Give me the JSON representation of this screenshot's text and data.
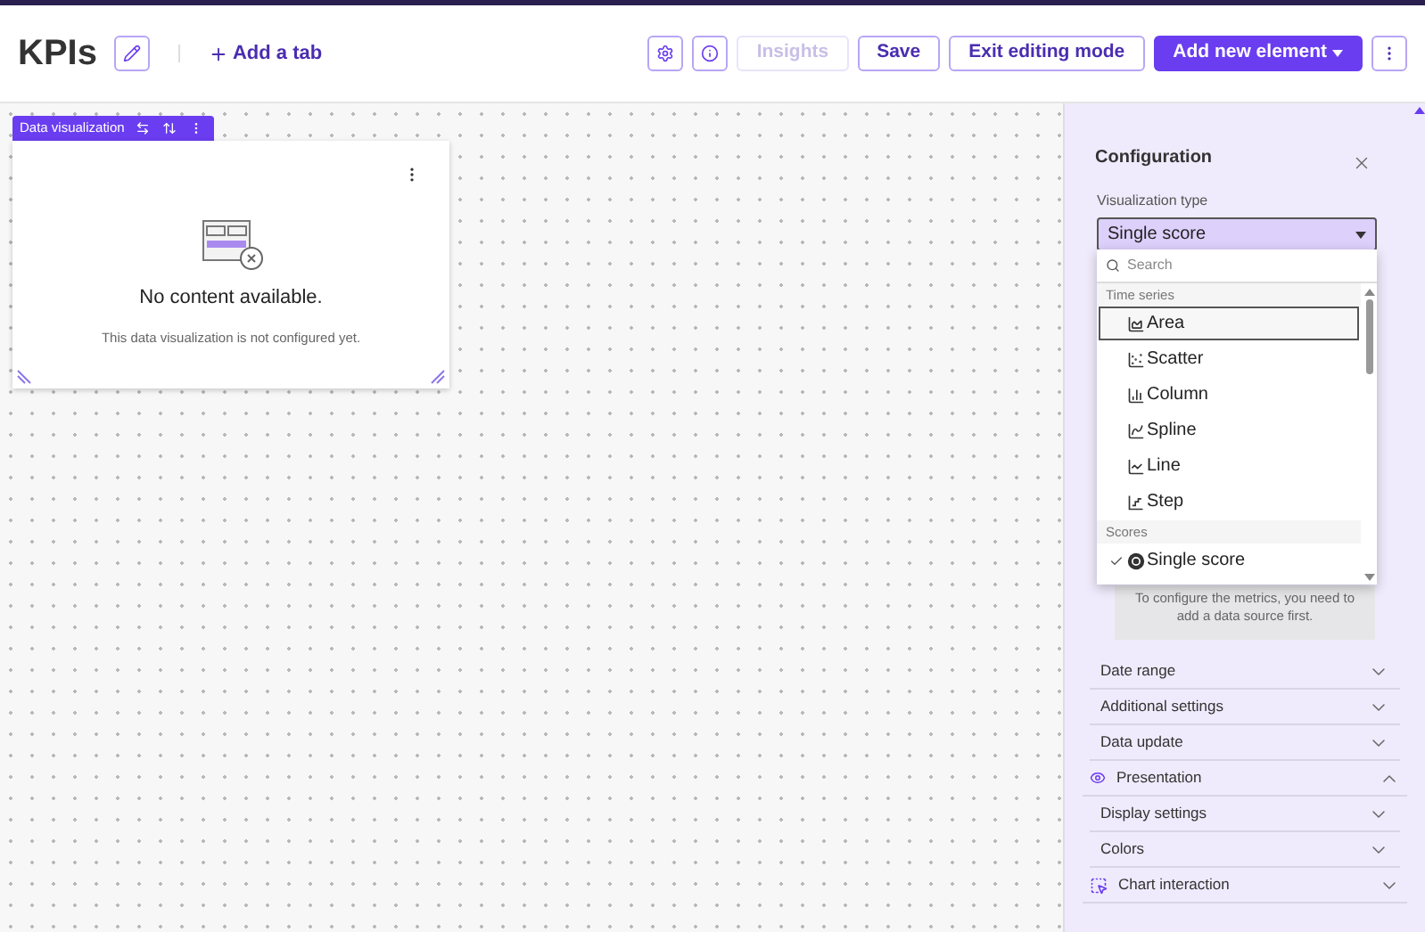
{
  "header": {
    "title": "KPIs",
    "add_tab": "Add a tab",
    "buttons": [
      {
        "label": "Insights",
        "disabled": true,
        "primary": false
      },
      {
        "label": "Save",
        "disabled": false,
        "primary": false
      },
      {
        "label": "Exit editing mode",
        "disabled": false,
        "primary": false
      },
      {
        "label": "Add new element",
        "disabled": false,
        "primary": true
      }
    ]
  },
  "widget": {
    "toolbar_label": "Data visualization",
    "empty_title": "No content available.",
    "empty_text": "This data visualization is not configured yet."
  },
  "panel": {
    "title": "Configuration",
    "field_label": "Visualization type",
    "field_value": "Single score",
    "dropdown": {
      "placeholder": "Search",
      "groups": [
        {
          "label": "Time series",
          "options": [
            {
              "kind": "area",
              "label": "Area",
              "selected": true,
              "checked": false
            },
            {
              "kind": "scatter",
              "label": "Scatter",
              "selected": false,
              "checked": false
            },
            {
              "kind": "column",
              "label": "Column",
              "selected": false,
              "checked": false
            },
            {
              "kind": "spline",
              "label": "Spline",
              "selected": false,
              "checked": false
            },
            {
              "kind": "line",
              "label": "Line",
              "selected": false,
              "checked": false
            },
            {
              "kind": "step",
              "label": "Step",
              "selected": false,
              "checked": false
            }
          ]
        },
        {
          "label": "Scores",
          "options": [
            {
              "kind": "score",
              "label": "Single score",
              "selected": false,
              "checked": true
            }
          ]
        }
      ]
    },
    "notice": "To configure the metrics, you need to add a data source first.",
    "sections": [
      {
        "kind": "sub",
        "label": "Date range",
        "expanded": false
      },
      {
        "kind": "sub",
        "label": "Additional settings",
        "expanded": false
      },
      {
        "kind": "sub",
        "label": "Data update",
        "expanded": false
      },
      {
        "kind": "presentation",
        "label": "Presentation",
        "expanded": true
      },
      {
        "kind": "sub",
        "label": "Display settings",
        "expanded": false
      },
      {
        "kind": "sub",
        "label": "Colors",
        "expanded": false
      },
      {
        "kind": "interaction",
        "label": "Chart interaction",
        "expanded": false
      }
    ]
  }
}
